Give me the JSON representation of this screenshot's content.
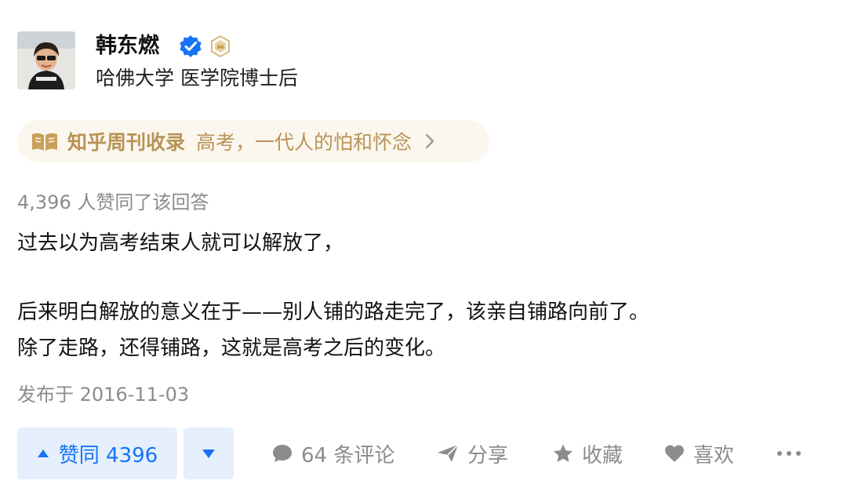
{
  "author": {
    "name": "韩东燃",
    "title": "哈佛大学 医学院博士后",
    "verified_color": "#1772f6",
    "badge_color": "#d7b87a"
  },
  "column": {
    "name": "知乎周刊收录",
    "topic": "高考，一代人的怕和怀念",
    "icon": "book-icon",
    "color": "#b89356"
  },
  "answer": {
    "vote_summary": "4,396 人赞同了该回答",
    "paragraphs": [
      "过去以为高考结束人就可以解放了，",
      "后来明白解放的意义在于——别人铺的路走完了，该亲自铺路向前了。",
      "除了走路，还得铺路，这就是高考之后的变化。"
    ],
    "published": "发布于 2016-11-03"
  },
  "actions": {
    "upvote_label": "赞同 4396",
    "comments_label": "64 条评论",
    "share_label": "分享",
    "collect_label": "收藏",
    "like_label": "喜欢",
    "more_icon": "more-icon",
    "accent": "#1772f6",
    "muted": "#8c8c8c"
  }
}
